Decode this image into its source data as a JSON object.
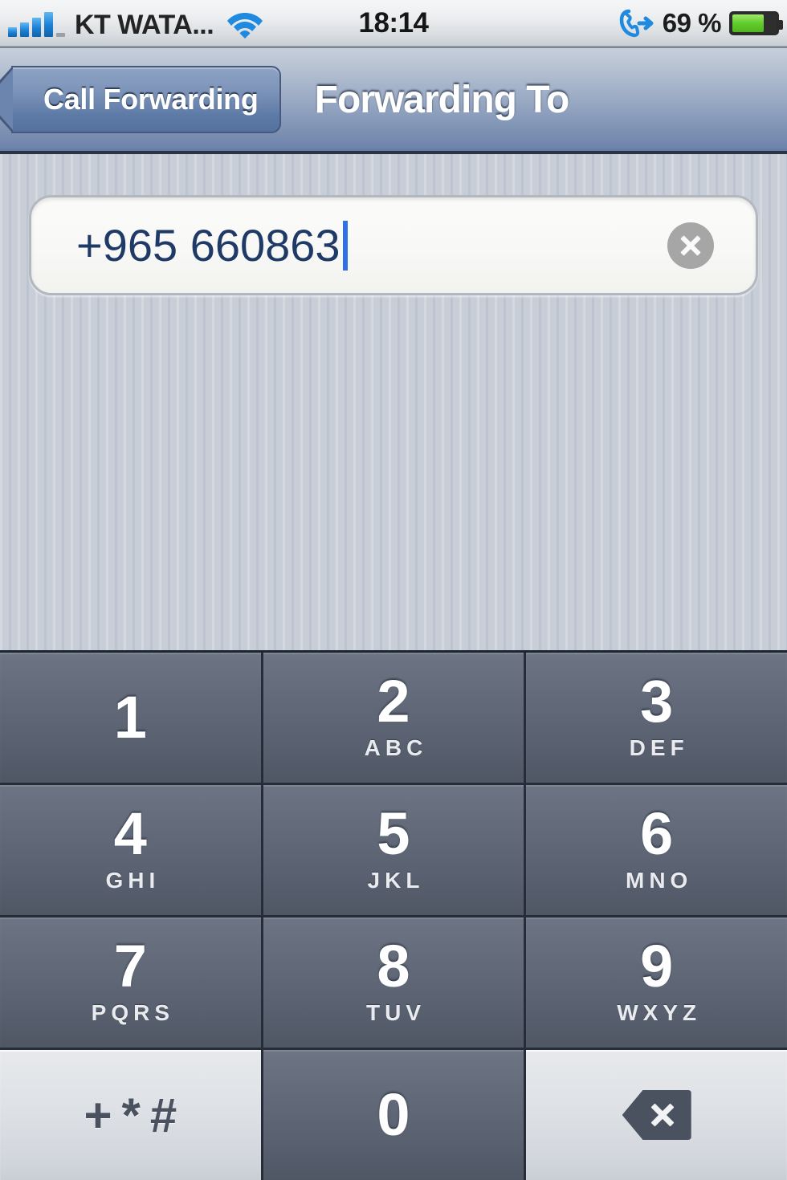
{
  "status_bar": {
    "carrier": "KT WATA...",
    "signal_bars_filled": 4,
    "signal_bars_total": 5,
    "wifi_icon": "wifi-icon",
    "time": "18:14",
    "call_forwarding_icon": "call-forwarding-icon",
    "battery_percent_label": "69 %",
    "battery_level": 69,
    "battery_color": "#62cc2c"
  },
  "nav_bar": {
    "back_label": "Call Forwarding",
    "title": "Forwarding To",
    "accent": "#6e84ab"
  },
  "field": {
    "value": "+965 660863",
    "placeholder": "",
    "text_color": "#1f3a66",
    "caret_color": "#2f6fe8",
    "clear_icon": "clear-circle-x-icon"
  },
  "keypad": {
    "rows": [
      [
        {
          "digit": "1",
          "letters": ""
        },
        {
          "digit": "2",
          "letters": "ABC"
        },
        {
          "digit": "3",
          "letters": "DEF"
        }
      ],
      [
        {
          "digit": "4",
          "letters": "GHI"
        },
        {
          "digit": "5",
          "letters": "JKL"
        },
        {
          "digit": "6",
          "letters": "MNO"
        }
      ],
      [
        {
          "digit": "7",
          "letters": "PQRS"
        },
        {
          "digit": "8",
          "letters": "TUV"
        },
        {
          "digit": "9",
          "letters": "WXYZ"
        }
      ]
    ],
    "bottom_row": {
      "symbols_label": "+*#",
      "zero_digit": "0",
      "backspace_icon": "backspace-delete-icon"
    },
    "key_color": "#626a78",
    "key_text_color": "#ffffff"
  }
}
